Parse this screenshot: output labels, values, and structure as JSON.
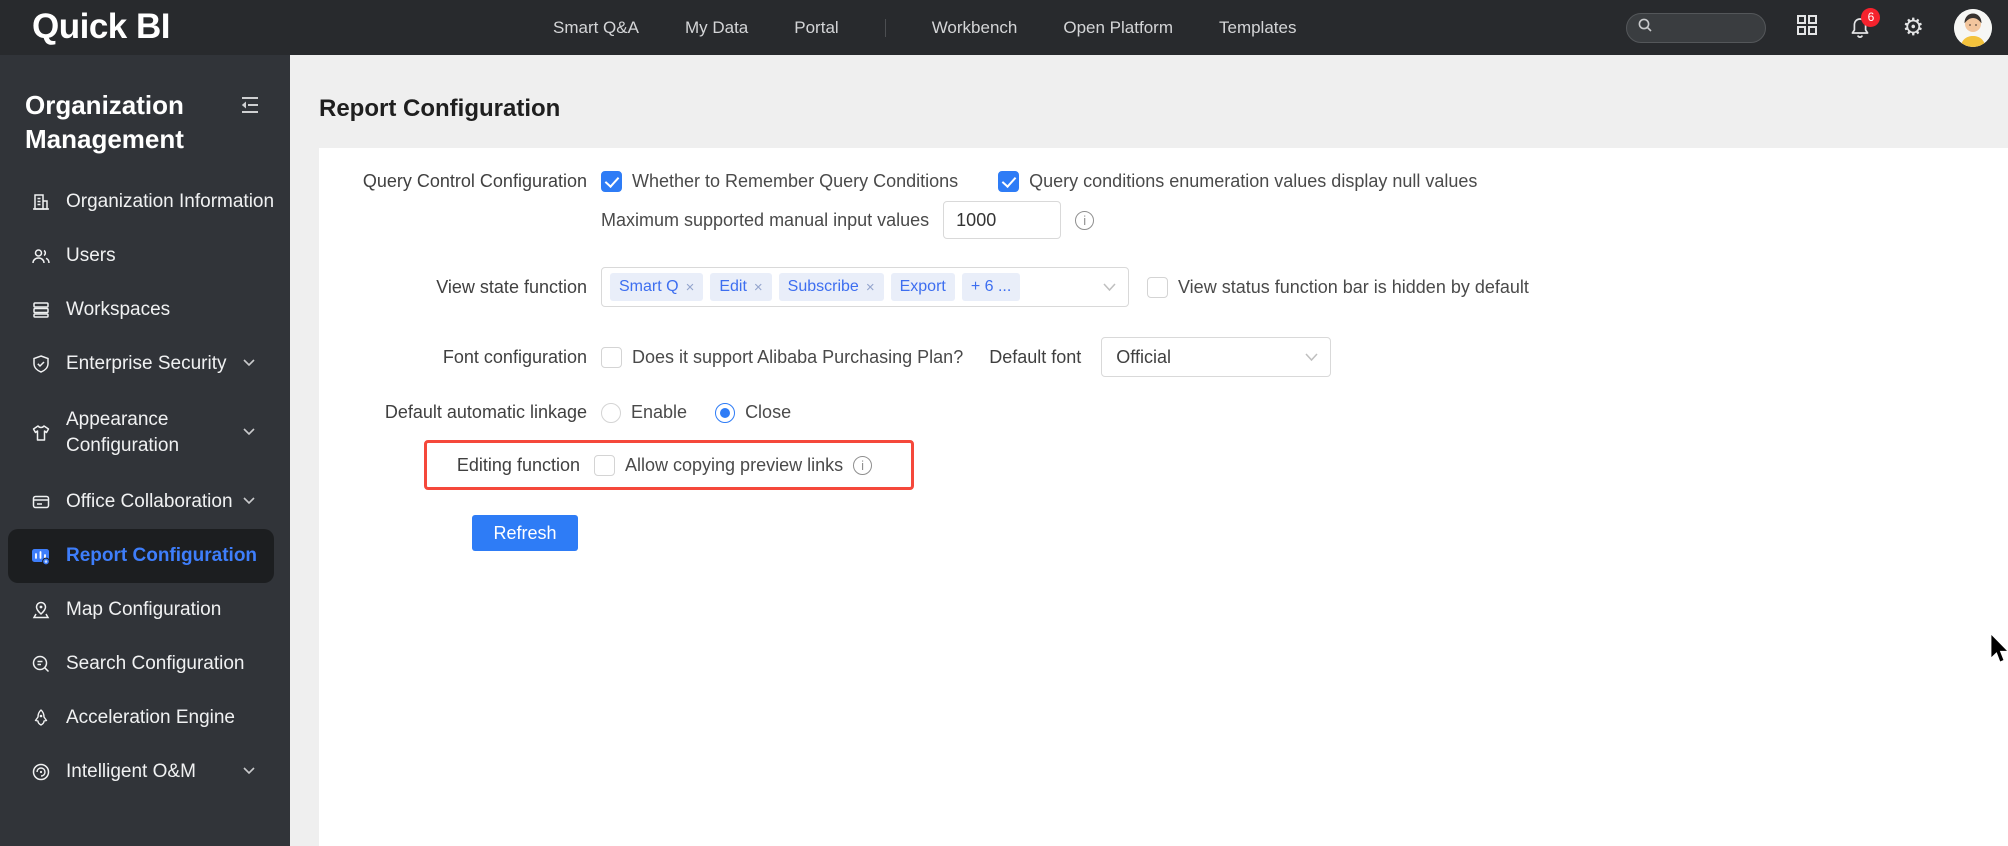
{
  "topbar": {
    "logo": "Quick BI",
    "nav": [
      {
        "label": "Smart Q&A"
      },
      {
        "label": "My Data"
      },
      {
        "label": "Portal"
      },
      {
        "label": "Workbench"
      },
      {
        "label": "Open Platform"
      },
      {
        "label": "Templates"
      }
    ],
    "notification_count": "6"
  },
  "sidebar": {
    "title": "Organization Management",
    "items": [
      {
        "label": "Organization Information",
        "icon": "building-icon"
      },
      {
        "label": "Users",
        "icon": "users-icon"
      },
      {
        "label": "Workspaces",
        "icon": "layers-icon"
      },
      {
        "label": "Enterprise Security",
        "icon": "shield-check-icon"
      },
      {
        "label": "Appearance Configuration",
        "icon": "tshirt-icon"
      },
      {
        "label": "Office Collaboration",
        "icon": "card-icon"
      },
      {
        "label": "Report Configuration",
        "icon": "report-icon",
        "active": true
      },
      {
        "label": "Map Configuration",
        "icon": "map-pin-icon"
      },
      {
        "label": "Search Configuration",
        "icon": "search-doc-icon"
      },
      {
        "label": "Acceleration Engine",
        "icon": "rocket-icon"
      },
      {
        "label": "Intelligent O&M",
        "icon": "gauge-icon"
      }
    ]
  },
  "main": {
    "page_title": "Report Configuration",
    "form": {
      "query_control": {
        "label": "Query Control Configuration",
        "checkbox_remember": {
          "label": "Whether to Remember Query Conditions",
          "checked": true
        },
        "checkbox_null_values": {
          "label": "Query conditions enumeration values display null values",
          "checked": true
        },
        "max_input_label": "Maximum supported manual input values",
        "max_input_value": "1000"
      },
      "view_state": {
        "label": "View state function",
        "tags": [
          {
            "text": "Smart Q",
            "removable": true
          },
          {
            "text": "Edit",
            "removable": true
          },
          {
            "text": "Subscribe",
            "removable": true
          },
          {
            "text": "Export",
            "removable": false
          },
          {
            "text": "+ 6 ...",
            "removable": false
          }
        ],
        "checkbox_hidden": {
          "label": "View status function bar is hidden by default",
          "checked": false
        }
      },
      "font_config": {
        "label": "Font configuration",
        "checkbox_alibaba": {
          "label": "Does it support Alibaba Purchasing Plan?",
          "checked": false
        },
        "default_font_label": "Default font",
        "default_font_value": "Official"
      },
      "auto_linkage": {
        "label": "Default automatic linkage",
        "option_enable": {
          "label": "Enable",
          "selected": false
        },
        "option_close": {
          "label": "Close",
          "selected": true
        }
      },
      "editing": {
        "label": "Editing function",
        "checkbox_copy": {
          "label": "Allow copying preview links",
          "checked": false
        }
      },
      "refresh_label": "Refresh"
    }
  },
  "colors": {
    "accent_blue": "#2e7cf6",
    "sidebar_active_text": "#3e7efb",
    "highlight_border": "#f5483b",
    "badge_red": "#f5222d",
    "topbar_bg": "#282a2d",
    "sidebar_bg": "#313439"
  }
}
